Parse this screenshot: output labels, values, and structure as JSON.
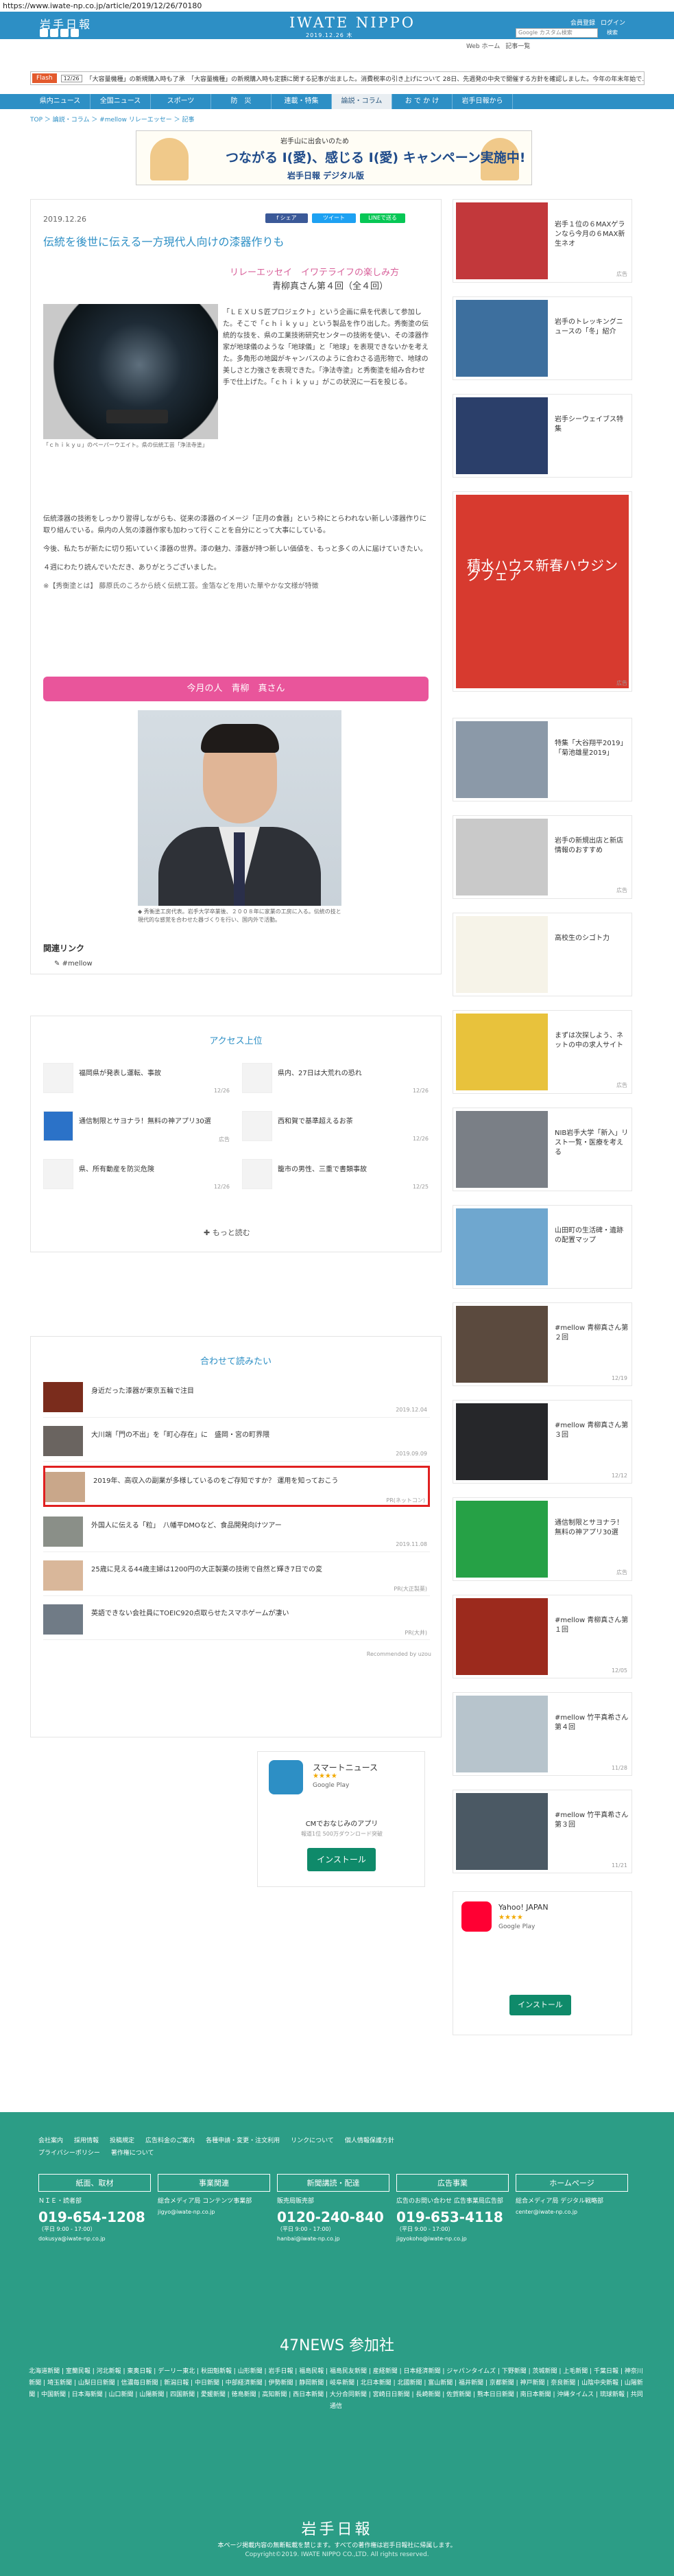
{
  "browser": {
    "url": "https://www.iwate-np.co.jp/article/2019/12/26/70180"
  },
  "header": {
    "logo": "岩手日報",
    "masthead": "IWATE NIPPO",
    "date": "2019.12.26 木",
    "login": "会員登録",
    "logout": "ログイン",
    "pills": [
      "Web版ホーム",
      "記事検索",
      "ご利用"
    ],
    "sub_links": [
      "Web ホーム",
      "記事一覧"
    ],
    "search_placeholder": "Google カスタム検索",
    "search_button": "検索"
  },
  "flash": {
    "label": "Flash",
    "time": "12/26",
    "text": "「大容量機種」の新規購入時も了承　「大容量機種」の新規購入時も定額に関する記事が出ました。消費税率の引き上げについて 28日、先週発の中央で開催する方針を確認しました。今年の年末年始で…"
  },
  "nav": {
    "items": [
      "県内ニュース",
      "全国ニュース",
      "スポーツ",
      "防　災",
      "連載・特集",
      "論説・コラム",
      "お で か け",
      "岩手日報から"
    ],
    "active": 5
  },
  "breadcrumb": "TOP ＞ 論説・コラム ＞ #mellow リレーエッセー ＞ 記事",
  "banner": {
    "line1": "岩手山に出会いのため",
    "line2": "つながる I(愛)、感じる I(愛) キャンペーン実施中!",
    "line3": "岩手日報 デジタル版"
  },
  "article": {
    "date": "2019.12.26",
    "share": [
      "f シェア",
      "ツイート",
      "LINEで送る"
    ],
    "title": "伝統を後世に伝える一方現代人向けの漆器作りも",
    "series": "リレーエッセイ　イワテライフの楽しみ方",
    "author": "青柳真さん第４回（全４回）",
    "photo1_caption": "「ｃｈｉｋｙｕ」のペーパーウエイト。県の伝統工芸「浄法寺塗」",
    "body1": "「ＬＥＸＵＳ匠プロジェクト」という企画に県を代表して参加した。そこで「ｃｈｉｋｙｕ」という製品を作り出した。秀衡塗の伝統的な技を、県の工業技術研究センターの技術を使い、その漆器作家が地球儀のような「地球儀」と「地球」を表現できないかを考えた。多角形の地図がキャンバスのように合わさる造形物で、地球の美しさと力強さを表現できた。「浄法寺塗」と秀衡塗を組み合わせ手で仕上げた。「ｃｈｉｋｙｕ」がこの状況に一石を投じる。",
    "body2": "伝統漆器の技術をしっかり習得しながらも、従来の漆器のイメージ「正月の食器」という枠にとらわれない新しい漆器作りに取り組んでいる。県内の人気の漆器作家も加わって行くことを自分にとって大事にしている。",
    "body3": "今後、私たちが新たに切り拓いていく漆器の世界。漆の魅力、漆器が持つ新しい価値を、もっと多くの人に届けていきたい。",
    "body4": "４週にわたり読んでいただき、ありがとうございました。",
    "note": "※【秀衡塗とは】 藤原氏のころから続く伝統工芸。金箔などを用いた華やかな文様が特徴",
    "today": "今月の人　青柳　真さん",
    "photo2_caption": "◆ 秀衡塗工房代表。岩手大学卒業後、２００８年に家業の工房に入る。伝統の技と現代的な感覚を合わせた器づくりを行い、国内外で活動。",
    "related": "関連リンク",
    "related_link": "#mellow"
  },
  "ranking": {
    "title": "アクセス上位",
    "items": [
      {
        "t": "福岡県が発表し運転、事故",
        "d": "12/26"
      },
      {
        "t": "県内、27日は大荒れの恐れ",
        "d": "12/26"
      },
      {
        "t": "通信制限とサヨナラ！無料の神アプリ30選",
        "d": "広告"
      },
      {
        "t": "西和賀で基準超えるお茶",
        "d": "12/26"
      },
      {
        "t": "県、所有動産を防災危険",
        "d": "12/26"
      },
      {
        "t": "籠市の男性、三重で書類事故",
        "d": "12/25"
      }
    ],
    "more": "もっと読む"
  },
  "recommend": {
    "title": "合わせて読みたい",
    "items": [
      {
        "t": "身近だった漆器が東京五輪で注目",
        "d": "2019.12.04"
      },
      {
        "t": "大川端「門の不出」を「町心存在」に　盛岡・宮の町界隈",
        "d": "2019.09.09"
      },
      {
        "t": "2019年、高収入の副業が多様しているのをご存知ですか？ 運用を知っておこう",
        "d": "PR(ネットコン)"
      },
      {
        "t": "外国人に伝える「粒」　八幡平DMOなど、食品開発向けツアー",
        "d": "2019.11.08"
      },
      {
        "t": "25歳に見える44歳主婦は1200円の大正製薬の技術で自然と輝き7日での変",
        "d": "PR(大正製薬)"
      },
      {
        "t": "英語できない会社員にTOEIC920点取らせたスマホゲームが凄い",
        "d": "PR(大井)"
      }
    ],
    "powered": "Recommended by uzou"
  },
  "app_ad": {
    "name": "スマートニュース",
    "store": "Google Play",
    "desc": "CMでおなじみのアプリ",
    "sub": "報道1位 500万ダウンロード突破",
    "button": "インストール"
  },
  "sidebar": [
    {
      "t": "岩手１位の６MAXゲランなら今月の６MAX新生ネオ",
      "d": "広告"
    },
    {
      "t": "岩手のトレッキングニュースの「冬」紹介",
      "d": ""
    },
    {
      "t": "岩手シーウェイブス特集",
      "d": ""
    },
    {
      "t": "積水ハウス新春ハウジングフェア",
      "d": "広告"
    },
    {
      "t": "特集「大谷翔平2019」「菊池雄星2019」",
      "d": ""
    },
    {
      "t": "岩手の新規出店と新店情報のおすすめ",
      "d": "広告"
    },
    {
      "t": "高校生のシゴト力",
      "d": ""
    },
    {
      "t": "まずは次探しよう、ネットの中の求人サイト",
      "d": "広告"
    },
    {
      "t": "NIB岩手大学「新入」リスト一覧・医療を考える",
      "d": ""
    },
    {
      "t": "山田町の生活碑・遺跡の配置マップ",
      "d": ""
    },
    {
      "t": "#mellow 青柳真さん第２回",
      "d": "12/19"
    },
    {
      "t": "#mellow 青柳真さん第３回",
      "d": "12/12"
    },
    {
      "t": "通信制限とサヨナラ！無料の神アプリ30選",
      "d": "広告"
    },
    {
      "t": "#mellow 青柳真さん第１回",
      "d": "12/05"
    },
    {
      "t": "#mellow 竹平真希さん第４回",
      "d": "11/28"
    },
    {
      "t": "#mellow 竹平真希さん第３回",
      "d": "11/21"
    }
  ],
  "side_app": {
    "name": "Yahoo! JAPAN",
    "store": "Google Play",
    "button": "インストール"
  },
  "footer": {
    "links": [
      "会社案内",
      "採用情報",
      "投稿規定",
      "広告料金のご案内",
      "各種申請・変更・注文利用",
      "リンクについて",
      "個人情報保護方針",
      "プライバシーポリシー",
      "著作権について"
    ],
    "cols": [
      {
        "h": "紙面、取材",
        "s": "ＮＩＥ・読者部",
        "p": "019-654-1208",
        "n": "（平日 9:00 - 17:00）",
        "m": "dokusya@iwate-np.co.jp"
      },
      {
        "h": "事業関連",
        "s": "総合メディア局 コンテンツ事業部",
        "p": "",
        "n": "",
        "m": "jigyo@iwate-np.co.jp"
      },
      {
        "h": "新聞講読・配達",
        "s": "販売局販売部",
        "p": "0120-240-840",
        "n": "（平日 9:00 - 17:00）",
        "m": "hanbai@iwate-np.co.jp"
      },
      {
        "h": "広告事業",
        "s": "広告のお問い合わせ 広告事業局広告部",
        "p": "019-653-4118",
        "n": "（平日 9:00 - 17:00）",
        "m": "jigyokoho@iwate-np.co.jp"
      },
      {
        "h": "ホームページ",
        "s": "総合メディア局 デジタル戦略部",
        "p": "",
        "n": "",
        "m": "center@iwate-np.co.jp"
      }
    ],
    "title47": "47NEWS 参加社",
    "members": "北海道新聞 | 室蘭民報 | 河北新報 | 東奥日報 | デーリー東北 | 秋田魁新報 | 山形新聞 | 岩手日報 | 福島民報 | 福島民友新聞 | 産経新聞 | 日本経済新聞 | ジャパンタイムズ | 下野新聞 | 茨城新聞 | 上毛新聞 | 千葉日報 | 神奈川新聞 | 埼玉新聞 | 山梨日日新聞 | 信濃毎日新聞 | 新潟日報 | 中日新聞 | 中部経済新聞 | 伊勢新聞 | 静岡新聞 | 岐阜新聞 | 北日本新聞 | 北國新聞 | 富山新聞 | 福井新聞 | 京都新聞 | 神戸新聞 | 奈良新聞 | 山陰中央新報 | 山陽新聞 | 中国新聞 | 日本海新聞 | 山口新聞 | 山陽新聞 | 四国新聞 | 愛媛新聞 | 徳島新聞 | 高知新聞 | 西日本新聞 | 大分合同新聞 | 宮崎日日新聞 | 長崎新聞 | 佐賀新聞 | 熊本日日新聞 | 南日本新聞 | 沖縄タイムス | 琉球新報 | 共同通信",
    "logo": "岩手日報",
    "note": "本ページ掲載内容の無断転載を禁じます。すべての著作権は岩手日報社に帰属します。",
    "copy": "Copyright©2019. IWATE NIPPO CO.,LTD. All rights reserved."
  }
}
